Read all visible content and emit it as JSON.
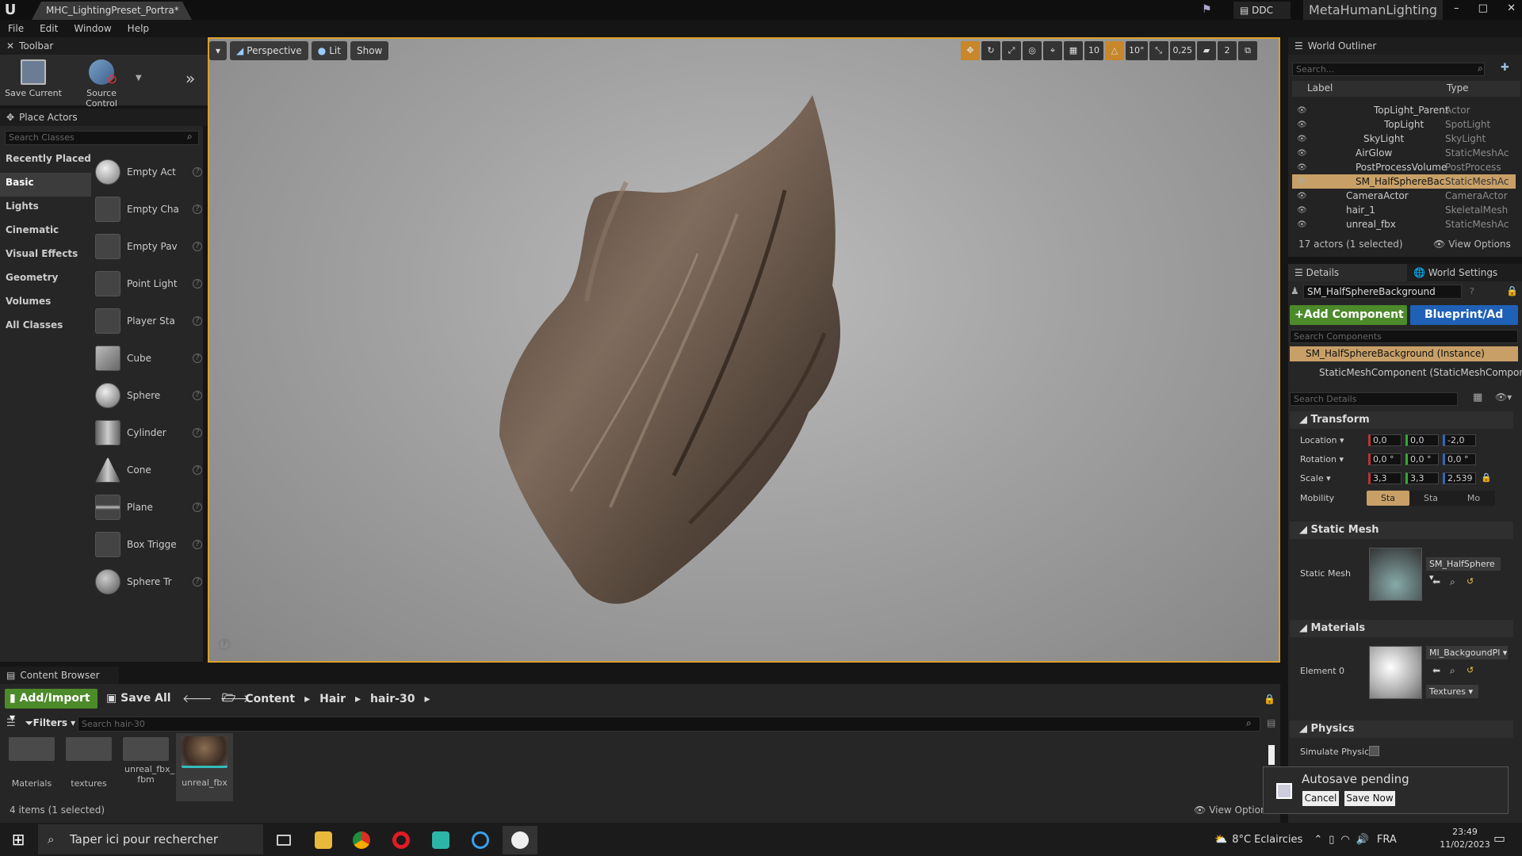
{
  "titlebar": {
    "document_tab": "MHC_LightingPreset_Portra*",
    "ddc": "DDC",
    "project": "MetaHumanLighting",
    "minimize": "–",
    "maximize": "□",
    "close": "✕"
  },
  "menu": [
    "File",
    "Edit",
    "Window",
    "Help"
  ],
  "toolbar": {
    "tab": "Toolbar",
    "save_current": "Save Current",
    "source_control": "Source Control"
  },
  "place_actors": {
    "tab": "Place Actors",
    "search_placeholder": "Search Classes",
    "categories": [
      "Recently Placed",
      "Basic",
      "Lights",
      "Cinematic",
      "Visual Effects",
      "Geometry",
      "Volumes",
      "All Classes"
    ],
    "items": [
      "Empty Act",
      "Empty Cha",
      "Empty Pav",
      "Point Light",
      "Player Sta",
      "Cube",
      "Sphere",
      "Cylinder",
      "Cone",
      "Plane",
      "Box Trigge",
      "Sphere Tr"
    ]
  },
  "viewport": {
    "perspective": "Perspective",
    "lit": "Lit",
    "show": "Show",
    "grid_snap": "10",
    "rot_snap": "10°",
    "scale_snap": "0,25",
    "cam_speed": "2"
  },
  "world_outliner": {
    "tab": "World Outliner",
    "search_placeholder": "Search...",
    "col_label": "Label",
    "col_type": "Type",
    "rows": [
      {
        "label": "TopLight_Parent",
        "type": "Actor"
      },
      {
        "label": "TopLight",
        "type": "SpotLight"
      },
      {
        "label": "SkyLight",
        "type": "SkyLight"
      },
      {
        "label": "AirGlow",
        "type": "StaticMeshAc"
      },
      {
        "label": "PostProcessVolume",
        "type": "PostProcess"
      },
      {
        "label": "SM_HalfSphereBackg",
        "type": "StaticMeshAc"
      },
      {
        "label": "CameraActor",
        "type": "CameraActor"
      },
      {
        "label": "hair_1",
        "type": "SkeletalMesh"
      },
      {
        "label": "unreal_fbx",
        "type": "StaticMeshAc"
      }
    ],
    "count": "17 actors (1 selected)",
    "view_options": "View Options"
  },
  "details": {
    "tab": "Details",
    "world_settings_tab": "World Settings",
    "actor_name": "SM_HalfSphereBackground",
    "add_component": "+Add Component",
    "blueprint": "Blueprint/Ad",
    "search_components": "Search Components",
    "instance": "SM_HalfSphereBackground (Instance)",
    "component": "StaticMeshComponent (StaticMeshComponent)",
    "search_details": "Search Details",
    "transform": "Transform",
    "location": "Location",
    "rotation": "Rotation",
    "scale": "Scale",
    "mobility": "Mobility",
    "loc": [
      "0,0",
      "0,0",
      "-2,0"
    ],
    "rot": [
      "0,0 °",
      "0,0 °",
      "0,0 °"
    ],
    "scl": [
      "3,3",
      "3,3",
      "2,539"
    ],
    "mob": [
      "Sta",
      "Sta",
      "Mo"
    ],
    "static_mesh_section": "Static Mesh",
    "static_mesh_label": "Static Mesh",
    "static_mesh_value": "SM_HalfSphere",
    "materials_section": "Materials",
    "element0": "Element 0",
    "material_value": "MI_BackgoundPl",
    "textures": "Textures",
    "physics_section": "Physics",
    "simulate_physics": "Simulate Physic"
  },
  "content_browser": {
    "tab": "Content Browser",
    "add_import": "Add/Import",
    "save_all": "Save All",
    "path": [
      "Content",
      "Hair",
      "hair-30"
    ],
    "filters": "Filters",
    "search_placeholder": "Search hair-30",
    "assets": [
      "Materials",
      "textures",
      "unreal_fbx_ fbm",
      "unreal_fbx"
    ],
    "count": "4 items (1 selected)",
    "view_options": "View Options"
  },
  "toast": {
    "title": "Autosave pending",
    "cancel": "Cancel",
    "save_now": "Save Now"
  },
  "taskbar": {
    "search": "Taper ici pour rechercher",
    "weather": "8°C Eclaircies",
    "lang": "FRA",
    "time": "23:49",
    "date": "11/02/2023"
  }
}
